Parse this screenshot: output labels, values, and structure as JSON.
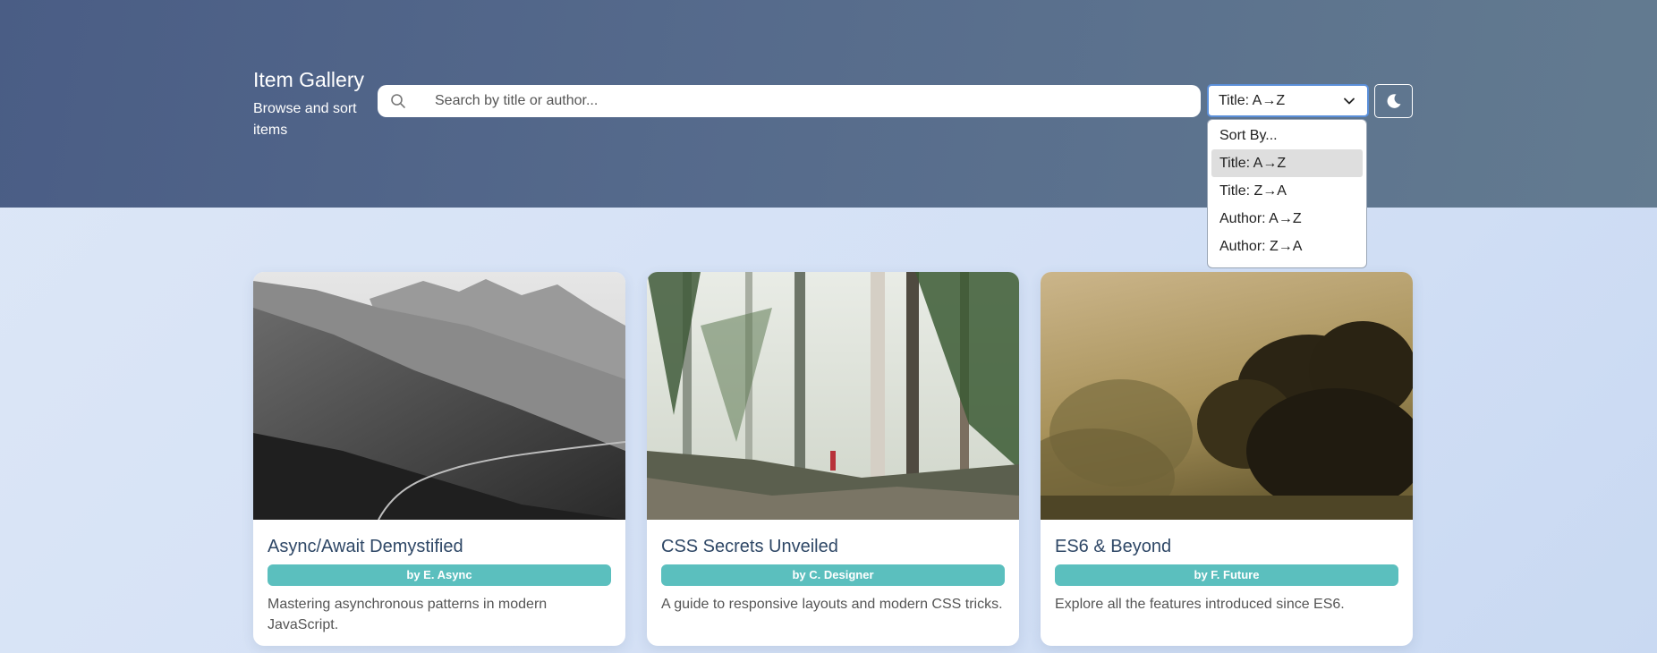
{
  "header": {
    "title": "Item Gallery",
    "subtitle": "Browse and sort items"
  },
  "search": {
    "placeholder": "Search by title or author...",
    "value": ""
  },
  "sort": {
    "selected_label": "Title: A→Z",
    "options": [
      "Sort By...",
      "Title: A→Z",
      "Title: Z→A",
      "Author: A→Z",
      "Author: Z→A"
    ],
    "highlighted_index": 1
  },
  "theme_toggle": {
    "icon": "moon-icon"
  },
  "cards": [
    {
      "title": "Async/Await Demystified",
      "author": "by E. Async",
      "description": "Mastering asynchronous patterns in modern JavaScript.",
      "image": "black-and-white mountain slope"
    },
    {
      "title": "CSS Secrets Unveiled",
      "author": "by C. Designer",
      "description": "A guide to responsive layouts and modern CSS tricks.",
      "image": "misty forest with hiker"
    },
    {
      "title": "ES6 & Beyond",
      "author": "by F. Future",
      "description": "Explore all the features introduced since ES6.",
      "image": "tree silhouettes in golden fog"
    }
  ],
  "colors": {
    "header_start": "#4a5d85",
    "header_end": "#637b90",
    "author_badge": "#5bbfbe",
    "card_title": "#2e4766",
    "select_focus": "#5b8fd9"
  }
}
